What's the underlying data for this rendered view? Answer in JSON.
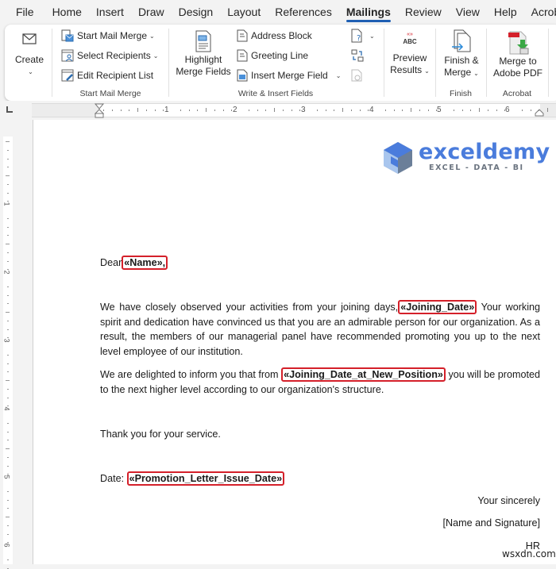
{
  "menu": {
    "tabs": [
      "File",
      "Home",
      "Insert",
      "Draw",
      "Design",
      "Layout",
      "References",
      "Mailings",
      "Review",
      "View",
      "Help",
      "Acrobat"
    ],
    "active": "Mailings"
  },
  "ribbon": {
    "create": {
      "label": "Create",
      "group": ""
    },
    "start_mail_merge": {
      "group": "Start Mail Merge",
      "items": [
        "Start Mail Merge",
        "Select Recipients",
        "Edit Recipient List"
      ]
    },
    "write_insert": {
      "group": "Write & Insert Fields",
      "highlight": [
        "Highlight",
        "Merge Fields"
      ],
      "items": [
        "Address Block",
        "Greeting Line",
        "Insert Merge Field"
      ]
    },
    "preview": {
      "label": [
        "Preview",
        "Results"
      ],
      "icon_text": "ABC"
    },
    "finish": {
      "group": "Finish",
      "label": [
        "Finish &",
        "Merge"
      ]
    },
    "acrobat": {
      "group": "Acrobat",
      "label": [
        "Merge to",
        "Adobe PDF"
      ]
    }
  },
  "ruler": {
    "numbers": [
      "1",
      "2",
      "3",
      "4",
      "5",
      "6"
    ]
  },
  "vruler": {
    "numbers": [
      "1",
      "2",
      "3",
      "4",
      "5",
      "6"
    ]
  },
  "logo": {
    "name": "exceldemy",
    "tagline": "EXCEL - DATA - BI"
  },
  "document": {
    "greeting_prefix": "Dear",
    "greeting_field": "«Name»,",
    "p1_before": "We have closely observed your activities from your joining days,",
    "p1_field": "«Joining_Date»",
    "p1_after": "Your working spirit and dedication have convinced us that you are an admirable person for our organization. As a result, the members of our managerial panel have recommended promoting you up to the next level employee of our institution.",
    "p2_before": "We are delighted to inform you that from",
    "p2_field": "«Joining_Date_at_New_Position»",
    "p2_after": "you will be promoted to the next higher level according to our organization's structure.",
    "thanks": "Thank you for your service.",
    "date_label": "Date:",
    "date_field": "«Promotion_Letter_Issue_Date»",
    "closing": "Your sincerely",
    "signature": "[Name and Signature]",
    "dept": "HR"
  },
  "watermark": "wsxdn.com",
  "colors": {
    "accent": "#1f5fb3",
    "field_border": "#d4202a",
    "logo_blue": "#4a7cdc"
  }
}
